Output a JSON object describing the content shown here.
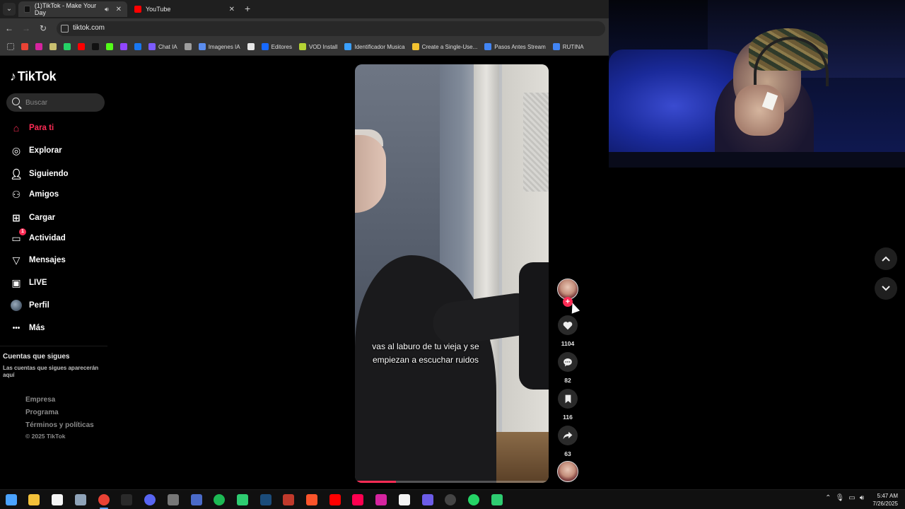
{
  "browser": {
    "tabs": [
      {
        "title": "(1)TikTok - Make Your Day",
        "active": true
      },
      {
        "title": "YouTube",
        "active": false
      }
    ],
    "url": "tiktok.com",
    "bookmarks": [
      {
        "label": "",
        "icon": "gmail-icon",
        "color": "#ea4335"
      },
      {
        "label": "",
        "icon": "instagram-icon",
        "color": "#d6249f"
      },
      {
        "label": "",
        "icon": "bookmark-app-icon",
        "color": "#c9c070"
      },
      {
        "label": "",
        "icon": "whatsapp-icon",
        "color": "#25d366"
      },
      {
        "label": "",
        "icon": "youtube-icon",
        "color": "#ff0000"
      },
      {
        "label": "",
        "icon": "tiktok-icon",
        "color": "#111111"
      },
      {
        "label": "",
        "icon": "kick-icon",
        "color": "#53fc18"
      },
      {
        "label": "",
        "icon": "twitch-icon",
        "color": "#9146ff"
      },
      {
        "label": "",
        "icon": "facebook-icon",
        "color": "#1877f2"
      },
      {
        "label": "Chat IA",
        "icon": "chat-ia-icon",
        "color": "#7c5cff"
      },
      {
        "label": "",
        "icon": "globe-icon",
        "color": "#9e9e9e"
      },
      {
        "label": "Imagenes IA",
        "icon": "search-bookmark-icon",
        "color": "#5b8def"
      },
      {
        "label": "",
        "icon": "notion-icon",
        "color": "#e8e8e8"
      },
      {
        "label": "Editores",
        "icon": "behance-icon",
        "color": "#1769ff"
      },
      {
        "label": "VOD Install",
        "icon": "vod-icon",
        "color": "#b5d334"
      },
      {
        "label": "Identificador Musica",
        "icon": "music-id-icon",
        "color": "#3aa0ff"
      },
      {
        "label": "Create a Single-Use...",
        "icon": "create-icon",
        "color": "#f2c230"
      },
      {
        "label": "Pasos Antes Stream",
        "icon": "docs-icon",
        "color": "#4285f4"
      },
      {
        "label": "RUTINA",
        "icon": "docs-icon",
        "color": "#4285f4"
      }
    ]
  },
  "tiktok": {
    "brand": "TikTok",
    "search_placeholder": "Buscar",
    "nav": [
      {
        "label": "Para ti",
        "icon": "home-icon",
        "active": true
      },
      {
        "label": "Explorar",
        "icon": "compass-icon"
      },
      {
        "label": "Siguiendo",
        "icon": "following-icon"
      },
      {
        "label": "Amigos",
        "icon": "friends-icon"
      },
      {
        "label": "Cargar",
        "icon": "upload-icon"
      },
      {
        "label": "Actividad",
        "icon": "activity-icon",
        "badge": "1"
      },
      {
        "label": "Mensajes",
        "icon": "messages-icon"
      },
      {
        "label": "LIVE",
        "icon": "live-icon"
      },
      {
        "label": "Perfil",
        "icon": "profile-avatar"
      },
      {
        "label": "Más",
        "icon": "more-icon"
      }
    ],
    "following_title": "Cuentas que sigues",
    "following_desc": "Las cuentas que sigues aparecerán aquí",
    "footer": [
      "Empresa",
      "Programa",
      "Términos y políticas"
    ],
    "copyright": "© 2025 TikTok",
    "video": {
      "caption": "vas al laburo de tu vieja y se empiezan a escuchar ruidos",
      "progress": 0.21
    },
    "actions": {
      "likes": "1104",
      "comments": "82",
      "saves": "116",
      "shares": "63"
    },
    "accent_color": "#fe2c55"
  },
  "taskbar": {
    "time": "5:47 AM",
    "date": "7/26/2025",
    "apps": [
      {
        "icon": "windows-start-icon",
        "color": "#4aa3ff"
      },
      {
        "icon": "file-explorer-icon",
        "color": "#f3c13a"
      },
      {
        "icon": "store-icon",
        "color": "#f5f5f5"
      },
      {
        "icon": "app-icon",
        "color": "#8fa3b8"
      },
      {
        "icon": "chrome-icon",
        "color": "#e94235",
        "active": true
      },
      {
        "icon": "epic-games-icon",
        "color": "#2a2a2a"
      },
      {
        "icon": "discord-icon",
        "color": "#5865f2"
      },
      {
        "icon": "app-icon",
        "color": "#777777"
      },
      {
        "icon": "settings-icon",
        "color": "#4a6ac8"
      },
      {
        "icon": "spotify-icon",
        "color": "#1db954"
      },
      {
        "icon": "app-icon",
        "color": "#2ecc71"
      },
      {
        "icon": "steam-icon",
        "color": "#1b4c7a"
      },
      {
        "icon": "app-icon",
        "color": "#c0392b"
      },
      {
        "icon": "brave-icon",
        "color": "#fb542b"
      },
      {
        "icon": "youtube-icon",
        "color": "#ff0000"
      },
      {
        "icon": "tiktok-icon",
        "color": "#ff0050"
      },
      {
        "icon": "instagram-icon",
        "color": "#d6249f"
      },
      {
        "icon": "capcut-icon",
        "color": "#f5f5f5"
      },
      {
        "icon": "app-icon",
        "color": "#6c5ce7"
      },
      {
        "icon": "obs-icon",
        "color": "#444444"
      },
      {
        "icon": "whatsapp-icon",
        "color": "#25d366"
      },
      {
        "icon": "app-icon",
        "color": "#2ecc71"
      }
    ]
  }
}
